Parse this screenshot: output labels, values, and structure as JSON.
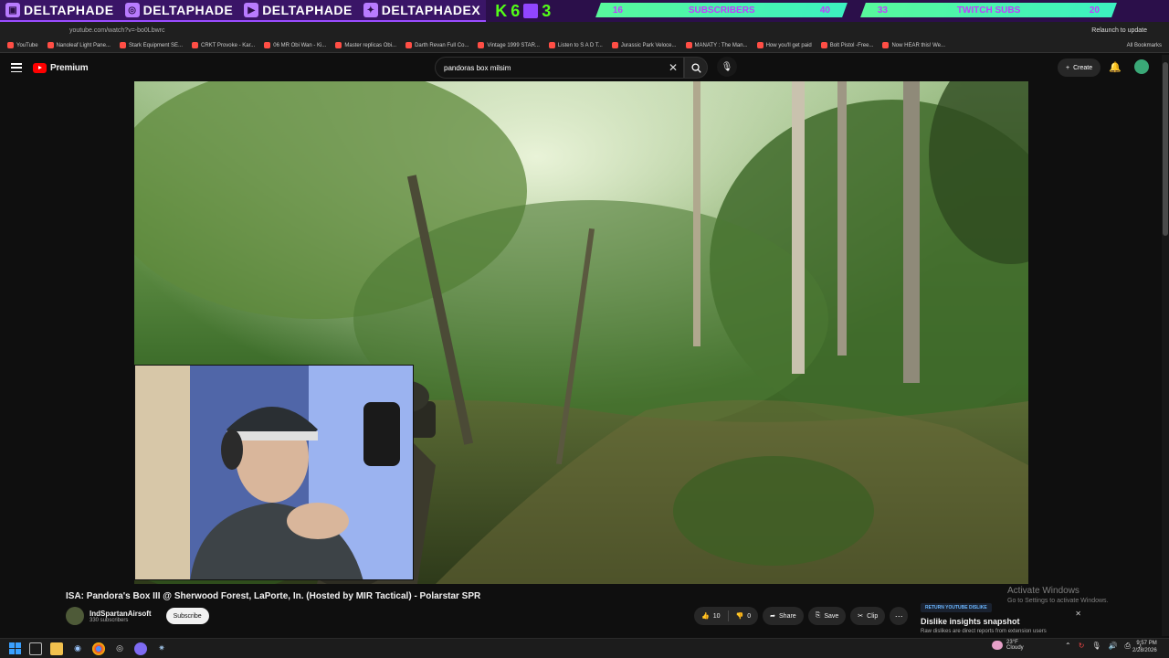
{
  "overlay": {
    "socials": [
      {
        "icon": "twitch-icon",
        "label": "DELTAPHADE"
      },
      {
        "icon": "instagram-icon",
        "label": "DELTAPHADE"
      },
      {
        "icon": "youtube-icon",
        "label": "DELTAPHADE"
      },
      {
        "icon": "twitter-icon",
        "label": "DELTAPHADEX"
      }
    ],
    "kick": {
      "letter": "K",
      "followers": "6",
      "twitch_count": "3"
    },
    "subs_goal": {
      "current": "16",
      "label": "SUBSCRIBERS",
      "target": "40"
    },
    "twitch_goal": {
      "current": "33",
      "label": "TWITCH SUBS",
      "target": "20"
    }
  },
  "browser": {
    "url": "youtube.com/watch?v=-bo0Lbwrc",
    "relaunch": "Relaunch to update",
    "bookmarks": [
      "YouTube",
      "Nanoleaf Light Pane...",
      "Stark Equipment SE...",
      "CRKT Provoke - Kar...",
      "06 MR Obi Wan - Ki...",
      "Master replicas Obi...",
      "Darth Revan Full Co...",
      "Vintage 1999 STAR...",
      "Listen to S A D T...",
      "Jurassic Park Veloce...",
      "MANATY : The Man...",
      "How you'll get paid",
      "Bolt Pistol -Free...",
      "Now HEAR this! We..."
    ],
    "all_bookmarks": "All Bookmarks"
  },
  "youtube": {
    "logo": "Premium",
    "search_query": "pandoras box milsim",
    "create_label": "Create",
    "video": {
      "title": "ISA: Pandora's Box III @ Sherwood Forest, LaPorte, In. (Hosted by MIR Tactical) - Polarstar SPR",
      "channel": "IndSpartanAirsoft",
      "subscribers": "330 subscribers",
      "subscribe_label": "Subscribe",
      "likes": "10",
      "dislikes": "0",
      "share_label": "Share",
      "save_label": "Save",
      "clip_label": "Clip"
    },
    "dislike_panel": {
      "badge": "RETURN YOUTUBE DISLIKE",
      "title": "Dislike insights snapshot",
      "subtitle": "Raw dislikes are direct reports from extension users"
    }
  },
  "windows": {
    "activate_title": "Activate Windows",
    "activate_sub": "Go to Settings to activate Windows.",
    "weather_temp": "23°F",
    "weather_desc": "Cloudy",
    "time": "9:57 PM",
    "date": "2/28/2026"
  }
}
